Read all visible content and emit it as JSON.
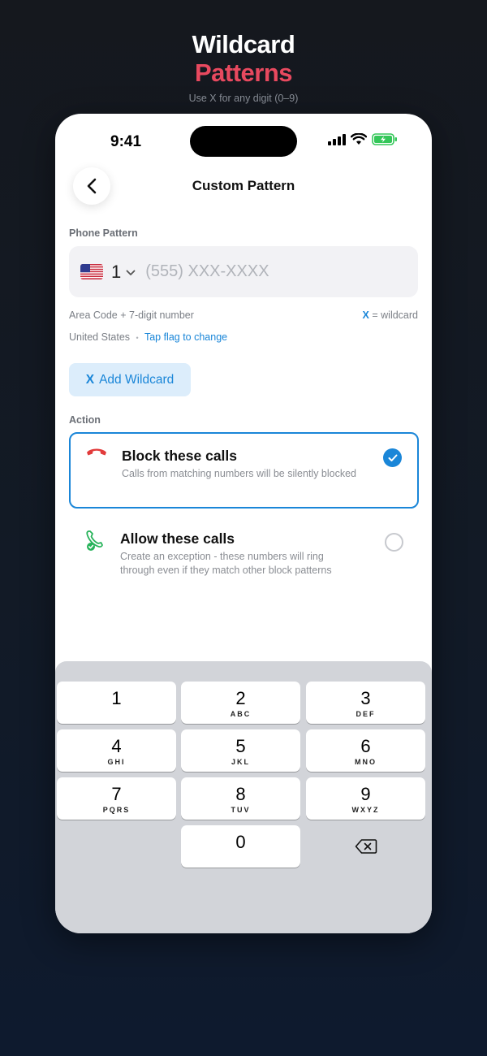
{
  "promo": {
    "line1": "Wildcard",
    "line2": "Patterns",
    "subtitle": "Use X for any digit (0–9)"
  },
  "status": {
    "time": "9:41"
  },
  "nav": {
    "title": "Custom Pattern"
  },
  "pattern": {
    "section_label": "Phone Pattern",
    "country_code": "1",
    "placeholder": "(555) XXX-XXXX",
    "value": "",
    "hint_left": "Area Code + 7-digit number",
    "hint_right_x": "X",
    "hint_right_text": "= wildcard",
    "country": "United States",
    "separator": "•",
    "change_link": "Tap flag to change"
  },
  "add_wildcard": {
    "x": "X",
    "label": "Add Wildcard"
  },
  "action": {
    "section_label": "Action",
    "block": {
      "title": "Block these calls",
      "description": "Calls from matching numbers will be silently blocked",
      "selected": true
    },
    "allow": {
      "title": "Allow these calls",
      "description": "Create an exception - these numbers will ring through even if they match other block patterns",
      "selected": false
    }
  },
  "keypad": {
    "keys": [
      {
        "num": "1",
        "letters": ""
      },
      {
        "num": "2",
        "letters": "ABC"
      },
      {
        "num": "3",
        "letters": "DEF"
      },
      {
        "num": "4",
        "letters": "GHI"
      },
      {
        "num": "5",
        "letters": "JKL"
      },
      {
        "num": "6",
        "letters": "MNO"
      },
      {
        "num": "7",
        "letters": "PQRS"
      },
      {
        "num": "8",
        "letters": "TUV"
      },
      {
        "num": "9",
        "letters": "WXYZ"
      },
      {
        "num": "0",
        "letters": ""
      }
    ]
  },
  "colors": {
    "accent": "#1a86d8",
    "promo_highlight": "#e8495f",
    "block_icon": "#e23b3b",
    "allow_icon": "#27b35a",
    "battery": "#34c759"
  },
  "icons": {
    "back": "chevron-left-icon",
    "block": "phone-hangup-icon",
    "allow": "phone-check-icon",
    "delete": "backspace-icon"
  }
}
